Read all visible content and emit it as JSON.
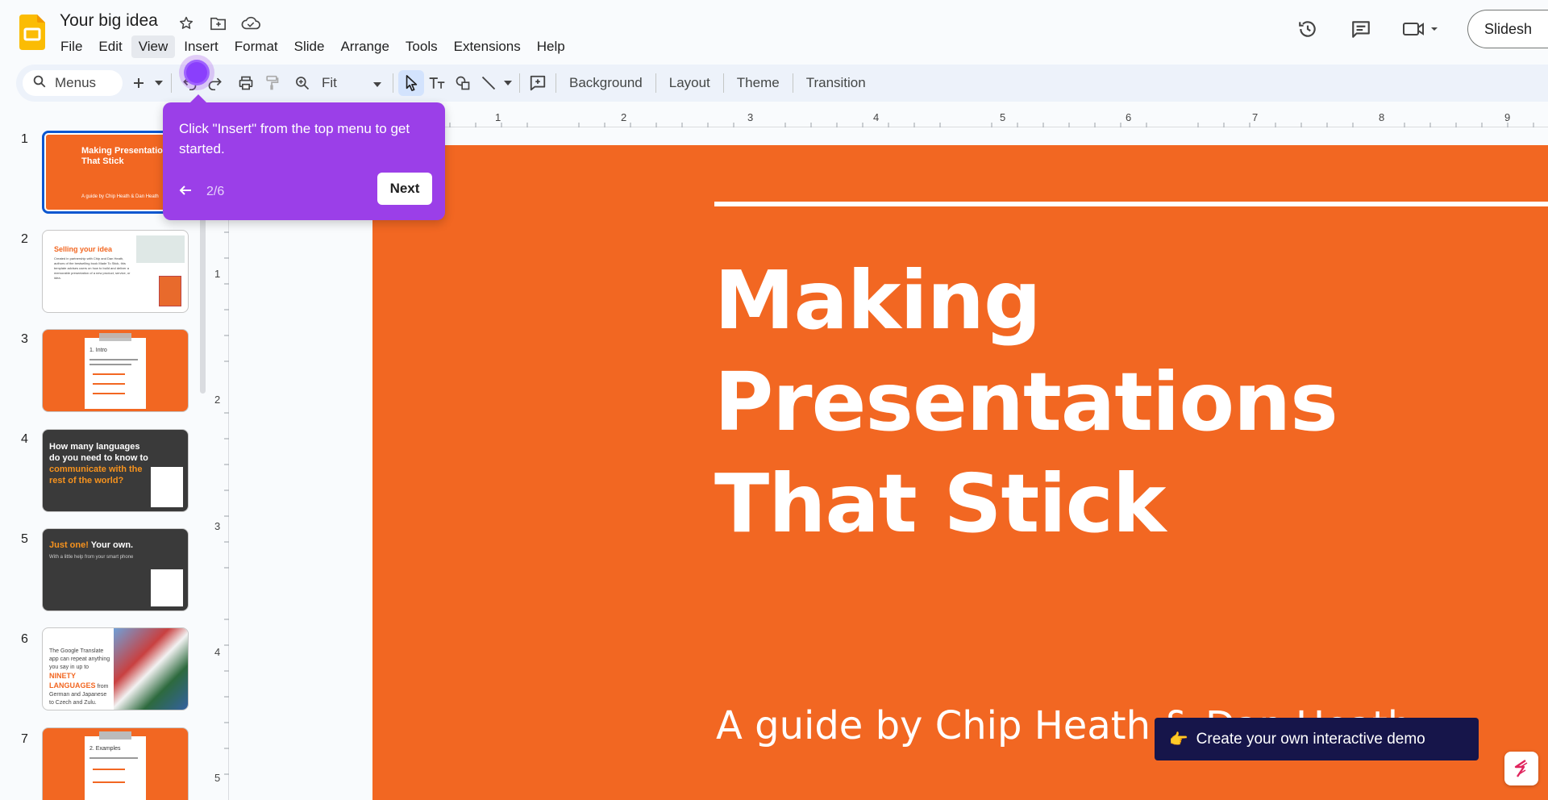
{
  "app": {
    "doc_title": "Your big idea",
    "menu": [
      "File",
      "Edit",
      "View",
      "Insert",
      "Format",
      "Slide",
      "Arrange",
      "Tools",
      "Extensions",
      "Help"
    ],
    "slideshow_label": "Slidesh"
  },
  "toolbar": {
    "search_label": "Menus",
    "zoom_value": "Fit",
    "buttons": [
      "Background",
      "Layout",
      "Theme",
      "Transition"
    ]
  },
  "ruler": {
    "top": [
      "1",
      "2",
      "3",
      "4",
      "5",
      "6",
      "7",
      "8",
      "9"
    ],
    "left": [
      "1",
      "2",
      "3",
      "4",
      "5"
    ]
  },
  "filmstrip": {
    "slides": [
      {
        "num": "1",
        "title": "Making Presentations That Stick",
        "caption": "A guide by Chip Heath & Dan Heath"
      },
      {
        "num": "2",
        "title": "Selling your idea",
        "caption": "Created in partnership with Chip and Dan Heath, authors of the bestselling book Made To Stick, this template advises users on how to build and deliver a memorable presentation of a new product, service, or idea."
      },
      {
        "num": "3",
        "title": "1. Intro"
      },
      {
        "num": "4",
        "title_white": "How many languages do you need to know to",
        "title_orange": "communicate with the rest of the world?"
      },
      {
        "num": "5",
        "title_orange": "Just one!",
        "title_white": "Your own.",
        "caption": "With a little help from your smart phone"
      },
      {
        "num": "6",
        "caption_pre": "The Google Translate app can repeat anything you say in up to",
        "caption_orange": "NINETY LANGUAGES",
        "caption_post": "from German and Japanese to Czech and Zulu."
      },
      {
        "num": "7",
        "title": "2. Examples"
      }
    ]
  },
  "slide": {
    "title": "Making Presentations That Stick",
    "subtitle": "A guide by Chip Heath & Dan Heath"
  },
  "tooltip": {
    "text": "Click \"Insert\" from the top menu to get started.",
    "progress": "2/6",
    "next_label": "Next"
  },
  "demo_banner": {
    "emoji": "👉",
    "label": "Create your own interactive demo"
  },
  "colors": {
    "slide_orange": "#f26722",
    "tooltip_purple": "#9b3fe8",
    "banner_navy": "#16154a",
    "selection_blue": "#0b57d0"
  }
}
